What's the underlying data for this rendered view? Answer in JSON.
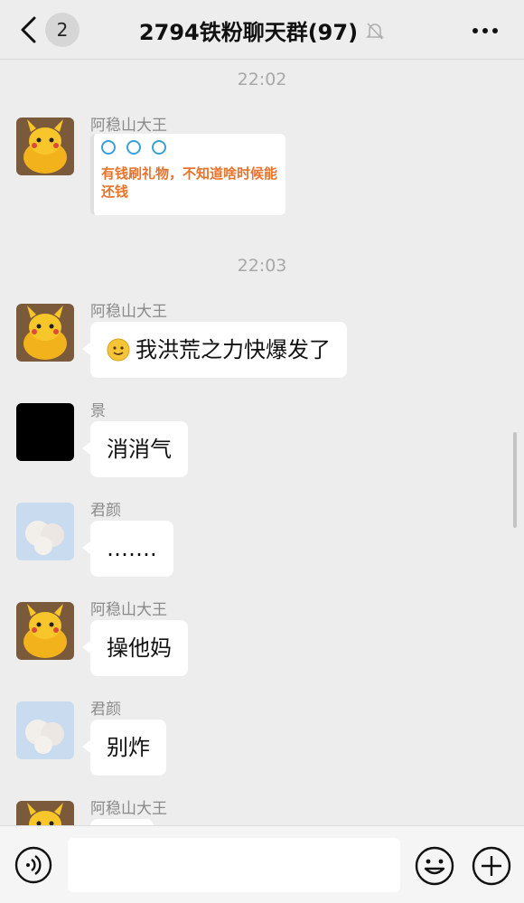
{
  "header": {
    "back_badge": "2",
    "title": "2794铁粉聊天群(97)"
  },
  "timestamps": [
    "22:02",
    "22:03"
  ],
  "messages": [
    {
      "sender": "阿稳山大王",
      "type": "image",
      "image_text": "有钱刷礼物，不知道啥时候能还钱"
    },
    {
      "sender": "阿稳山大王",
      "text": "我洪荒之力快爆发了"
    },
    {
      "sender": "景",
      "text": "消消气"
    },
    {
      "sender": "君颜",
      "text": "……."
    },
    {
      "sender": "阿稳山大王",
      "text": "操他妈"
    },
    {
      "sender": "君颜",
      "text": "别炸"
    },
    {
      "sender": "阿稳山大王",
      "text": ""
    }
  ],
  "colors": {
    "background": "#ededed",
    "bubble": "#ffffff",
    "timestamp": "#a8a8a8",
    "image_text": "#e8732a"
  },
  "icons": [
    "back-chevron-icon",
    "mute-bell-icon",
    "more-dots-icon",
    "voice-icon",
    "emoji-icon",
    "plus-icon"
  ]
}
